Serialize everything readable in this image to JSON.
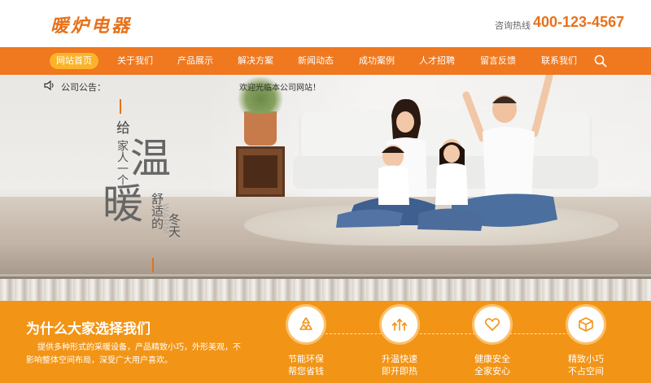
{
  "header": {
    "logo_text": "暖炉电器",
    "hotline_label": "咨询热线",
    "hotline_number": "400-123-4567"
  },
  "nav": {
    "items": [
      {
        "label": "网站首页",
        "active": true
      },
      {
        "label": "关于我们"
      },
      {
        "label": "产品展示"
      },
      {
        "label": "解决方案"
      },
      {
        "label": "新闻动态"
      },
      {
        "label": "成功案例"
      },
      {
        "label": "人才招聘"
      },
      {
        "label": "留言反馈"
      },
      {
        "label": "联系我们"
      }
    ],
    "search_icon": "search-icon"
  },
  "banner": {
    "notice_label": "公司公告：",
    "notice_text": "欢迎光临本公司网站！",
    "slogan": {
      "gei": "给",
      "jiaren": "家人一个",
      "wen": "温",
      "nuan": "暖",
      "shushi": "舒适的",
      "dongtian": "冬天",
      "warm": "WARM"
    }
  },
  "why": {
    "title": "为什么大家选择我们",
    "description": "提供多种形式的采暖设备，产品精致小巧，外形美观，不影响整体空间布局，深受广大用户喜欢。",
    "features": [
      {
        "icon": "recycle-icon",
        "line1": "节能环保",
        "line2": "帮您省钱"
      },
      {
        "icon": "arrows-up-icon",
        "line1": "升温快速",
        "line2": "即开即热"
      },
      {
        "icon": "heart-icon",
        "line1": "健康安全",
        "line2": "全家安心"
      },
      {
        "icon": "box-icon",
        "line1": "精致小巧",
        "line2": "不占空间"
      }
    ]
  },
  "colors": {
    "brand_orange": "#f0781e",
    "section_orange": "#f29415",
    "active_pill": "#fbb32a"
  }
}
